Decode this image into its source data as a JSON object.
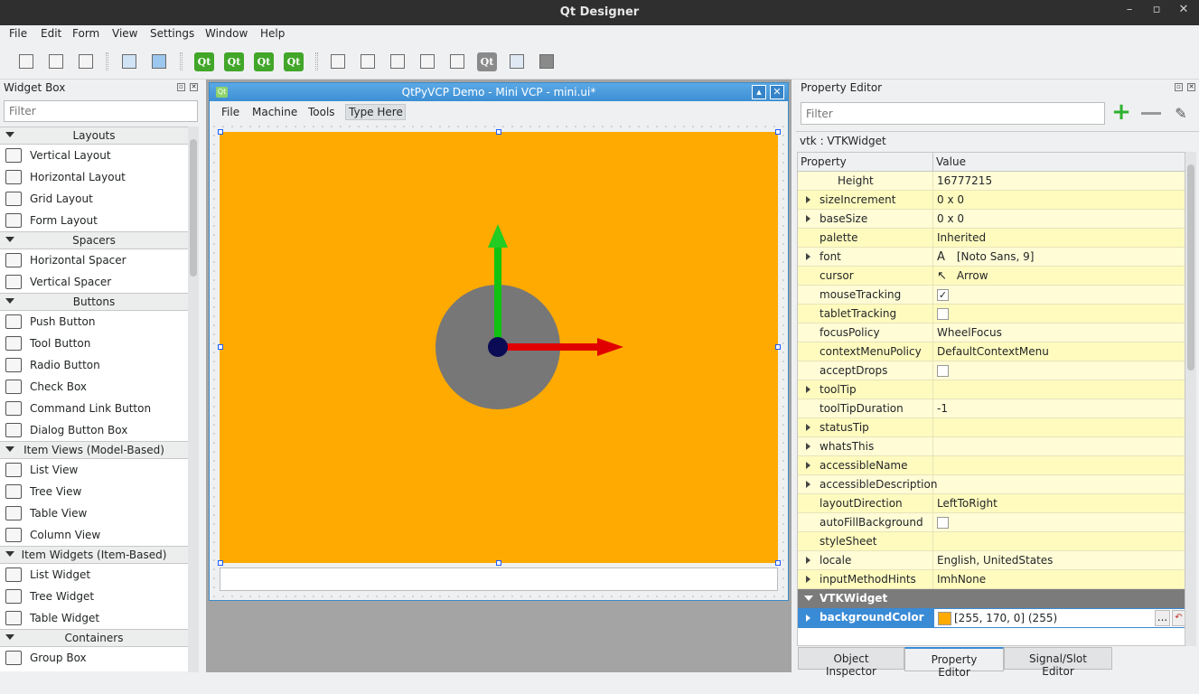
{
  "app": {
    "title": "Qt Designer"
  },
  "menu": [
    "File",
    "Edit",
    "Form",
    "View",
    "Settings",
    "Window",
    "Help"
  ],
  "widget_box": {
    "title": "Widget Box",
    "filter_placeholder": "Filter",
    "categories": [
      {
        "name": "Layouts",
        "items": [
          "Vertical Layout",
          "Horizontal Layout",
          "Grid Layout",
          "Form Layout"
        ]
      },
      {
        "name": "Spacers",
        "items": [
          "Horizontal Spacer",
          "Vertical Spacer"
        ]
      },
      {
        "name": "Buttons",
        "items": [
          "Push Button",
          "Tool Button",
          "Radio Button",
          "Check Box",
          "Command Link Button",
          "Dialog Button Box"
        ]
      },
      {
        "name": "Item Views (Model-Based)",
        "items": [
          "List View",
          "Tree View",
          "Table View",
          "Column View"
        ]
      },
      {
        "name": "Item Widgets (Item-Based)",
        "items": [
          "List Widget",
          "Tree Widget",
          "Table Widget"
        ]
      },
      {
        "name": "Containers",
        "items": [
          "Group Box"
        ]
      }
    ]
  },
  "form": {
    "title": "QtPyVCP Demo - Mini VCP - mini.ui*",
    "menu": [
      "File",
      "Machine",
      "Tools",
      "Type Here"
    ],
    "icon_text": "Qt"
  },
  "property_editor": {
    "title": "Property Editor",
    "filter_placeholder": "Filter",
    "object": "vtk : VTKWidget",
    "col_property": "Property",
    "col_value": "Value",
    "rows": [
      {
        "name": "Height",
        "value": "16777215",
        "expand": false,
        "indent": true
      },
      {
        "name": "sizeIncrement",
        "value": "0 x 0",
        "expand": true
      },
      {
        "name": "baseSize",
        "value": "0 x 0",
        "expand": true
      },
      {
        "name": "palette",
        "value": "Inherited",
        "expand": false
      },
      {
        "name": "font",
        "value": "[Noto Sans, 9]",
        "expand": true,
        "glyph": "A"
      },
      {
        "name": "cursor",
        "value": "Arrow",
        "expand": false,
        "glyph": "↖"
      },
      {
        "name": "mouseTracking",
        "value": "",
        "expand": false,
        "check": true
      },
      {
        "name": "tabletTracking",
        "value": "",
        "expand": false,
        "check": false
      },
      {
        "name": "focusPolicy",
        "value": "WheelFocus",
        "expand": false
      },
      {
        "name": "contextMenuPolicy",
        "value": "DefaultContextMenu",
        "expand": false
      },
      {
        "name": "acceptDrops",
        "value": "",
        "expand": false,
        "check": false
      },
      {
        "name": "toolTip",
        "value": "",
        "expand": true
      },
      {
        "name": "toolTipDuration",
        "value": "-1",
        "expand": false
      },
      {
        "name": "statusTip",
        "value": "",
        "expand": true
      },
      {
        "name": "whatsThis",
        "value": "",
        "expand": true
      },
      {
        "name": "accessibleName",
        "value": "",
        "expand": true
      },
      {
        "name": "accessibleDescription",
        "value": "",
        "expand": true
      },
      {
        "name": "layoutDirection",
        "value": "LeftToRight",
        "expand": false
      },
      {
        "name": "autoFillBackground",
        "value": "",
        "expand": false,
        "check": false
      },
      {
        "name": "styleSheet",
        "value": "",
        "expand": false
      },
      {
        "name": "locale",
        "value": "English, UnitedStates",
        "expand": true
      },
      {
        "name": "inputMethodHints",
        "value": "ImhNone",
        "expand": true
      }
    ],
    "section": "VTKWidget",
    "selected": {
      "name": "backgroundColor",
      "value": "[255, 170, 0] (255)",
      "swatch": "#ffaa00",
      "more_label": "..."
    },
    "tabs": [
      "Object Inspector",
      "Property Editor",
      "Signal/Slot Editor"
    ]
  },
  "colors": {
    "vtk_background": "#ffaa00",
    "selection": "#3a8bd6"
  }
}
